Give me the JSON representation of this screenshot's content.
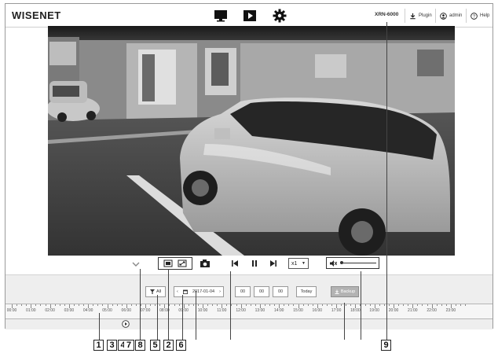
{
  "header": {
    "logo": "WISENET",
    "model": "XRN-6000",
    "plugin_label": "Plugin",
    "user_label": "admin",
    "help_label": "Help",
    "nav_icons": [
      "monitor-icon",
      "playback-icon",
      "gear-icon"
    ]
  },
  "controls": {
    "speed_label": "x1"
  },
  "timeline": {
    "filter_label": "All",
    "date_label": "2017-01-04",
    "today_label": "Today",
    "backup_label": "Backup",
    "zoom_buttons": [
      "00",
      "00",
      "00"
    ],
    "hours": [
      "00:00",
      "01:00",
      "02:00",
      "03:00",
      "04:00",
      "05:00",
      "06:00",
      "07:00",
      "08:00",
      "09:00",
      "10:00",
      "11:00",
      "12:00",
      "13:00",
      "14:00",
      "15:00",
      "16:00",
      "17:00",
      "18:00",
      "19:00",
      "20:00",
      "21:00",
      "22:00",
      "23:00"
    ]
  },
  "callouts": {
    "c1": "1",
    "c3": "3",
    "c4": "4",
    "c7": "7",
    "c8": "8",
    "c5": "5",
    "c2": "2",
    "c6": "6",
    "c9": "9"
  },
  "colors": {
    "backup_button": "#b3b3b3",
    "panel_bg": "#eeeeee"
  }
}
